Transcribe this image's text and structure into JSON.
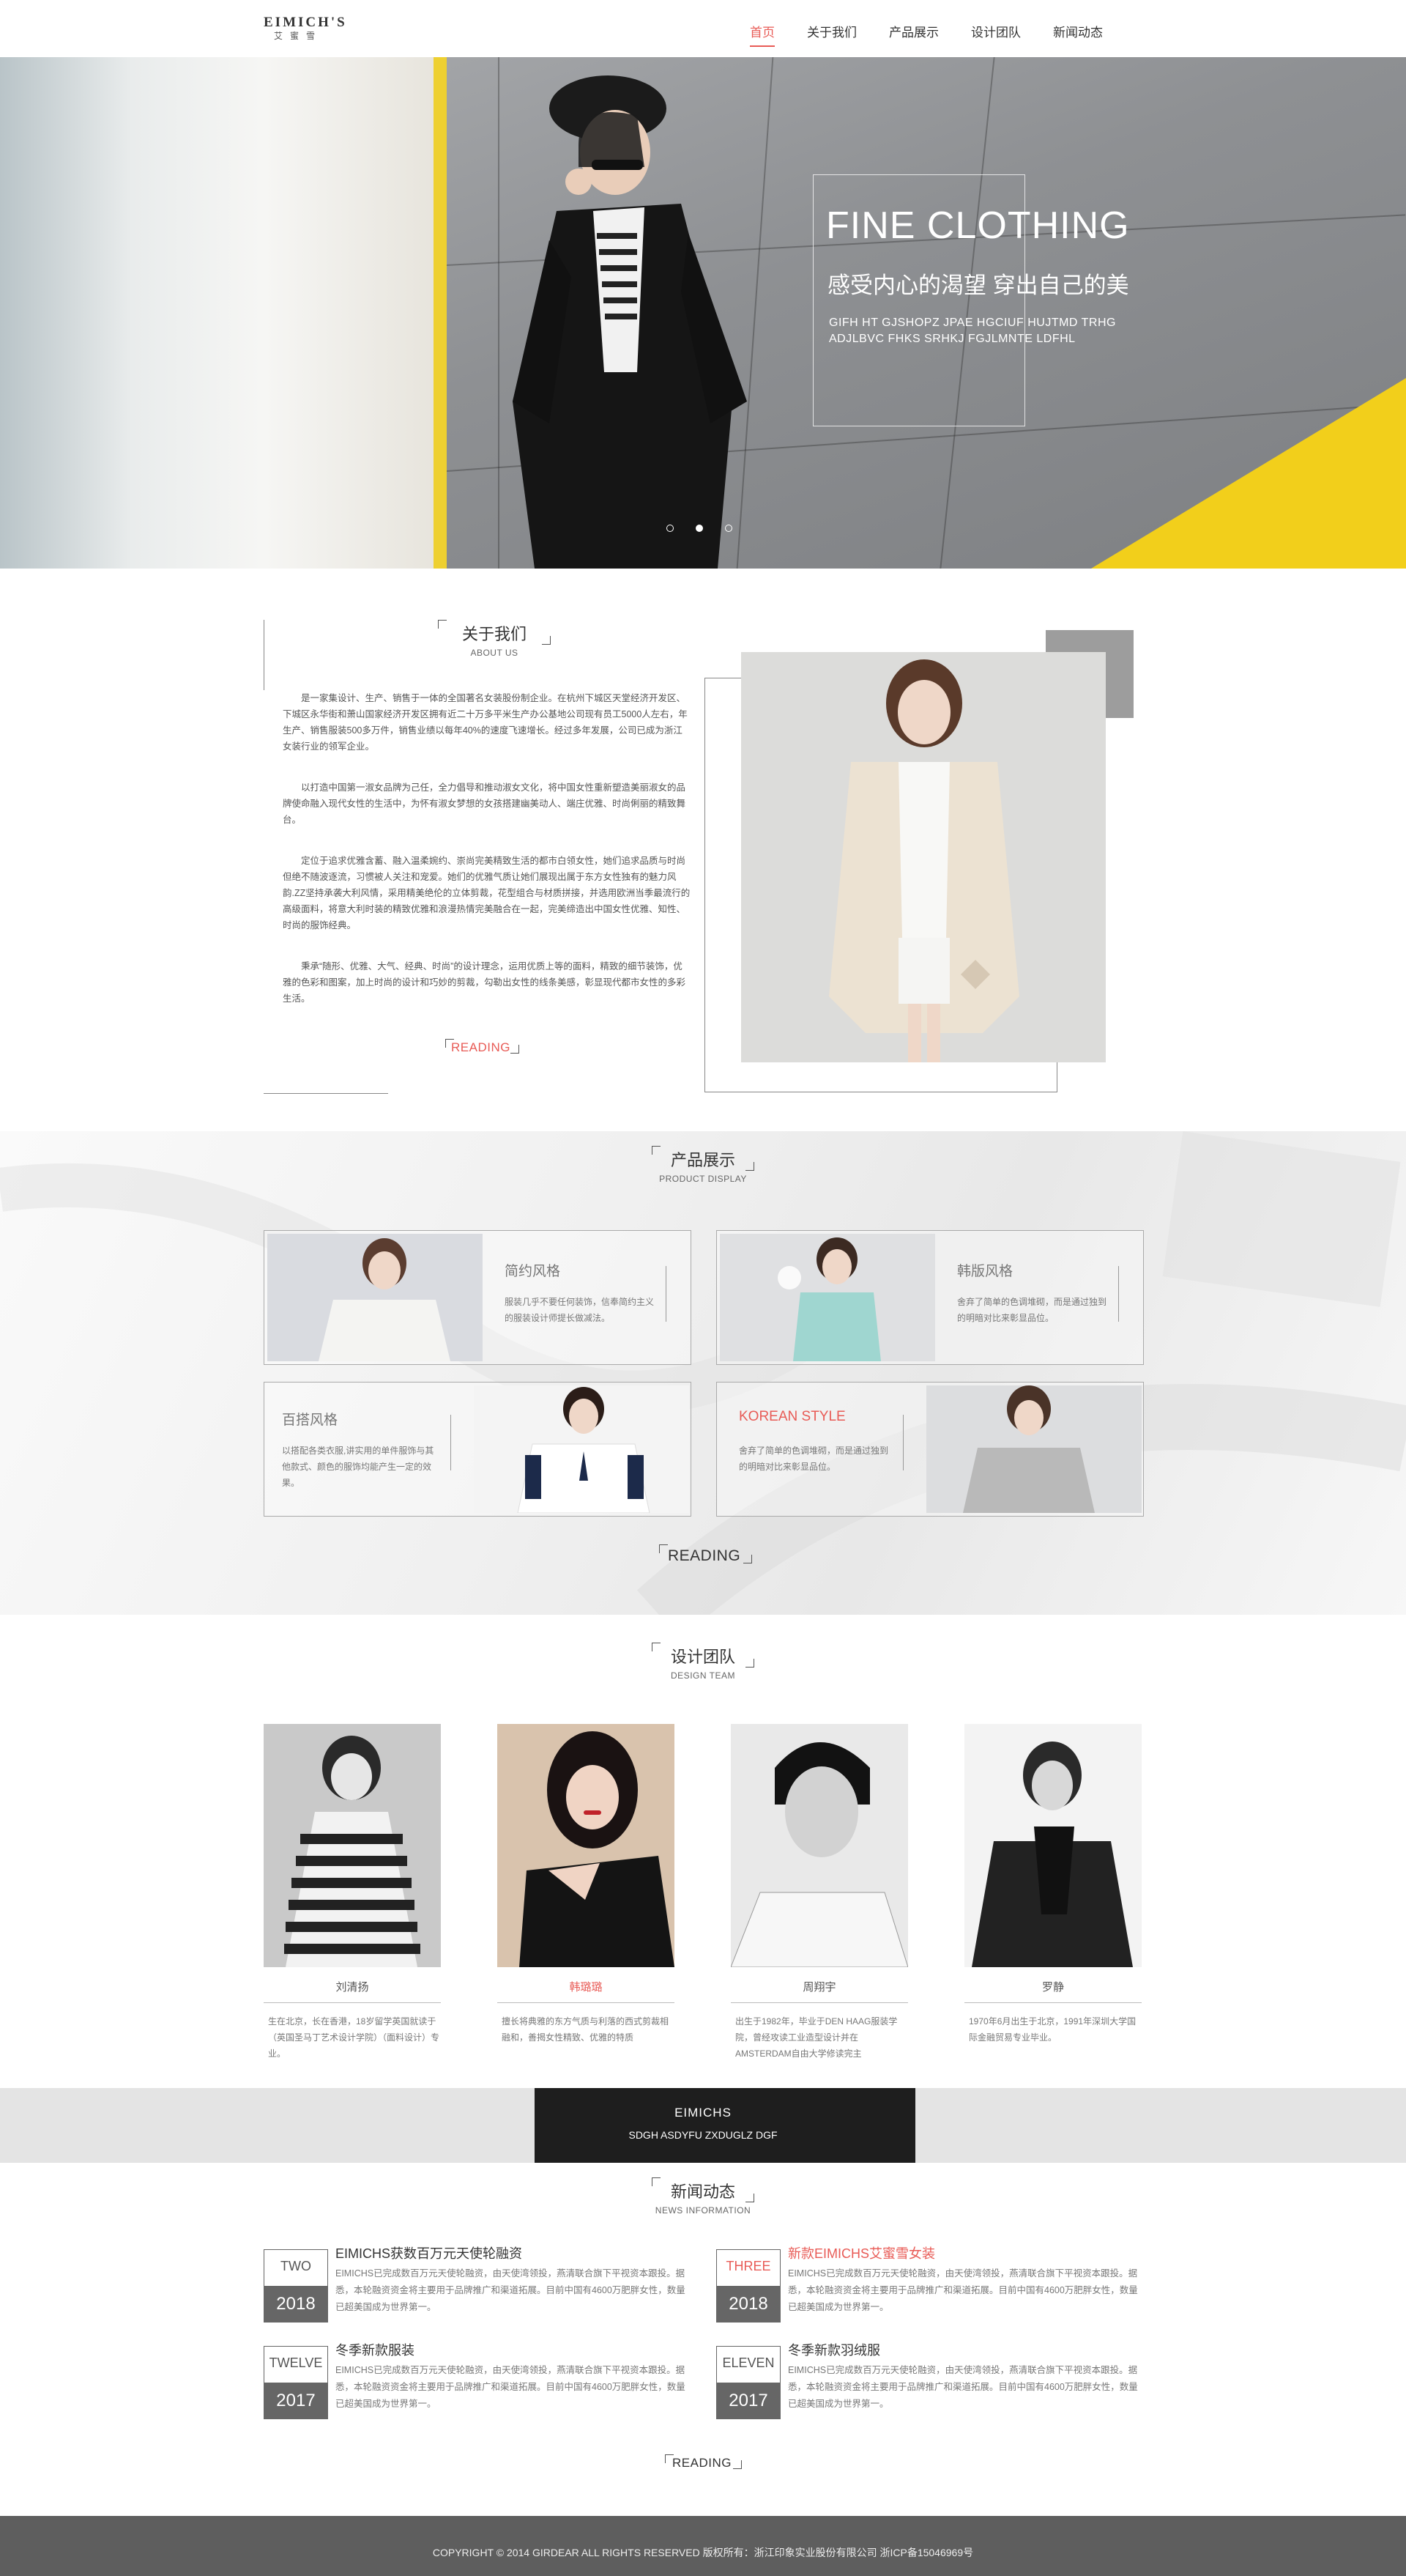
{
  "header": {
    "logo_en": "EIMICH'S",
    "logo_cn": "艾蜜雪",
    "nav": [
      "首页",
      "关于我们",
      "产品展示",
      "设计团队",
      "新闻动态"
    ]
  },
  "hero": {
    "title": "FINE CLOTHING",
    "subtitle": "感受内心的渴望 穿出自己的美",
    "desc": "GIFH HT GJSHOPZ JPAE HGCIUF HUJTMD TRHG ADJLBVC FHKS SRHKJ FGJLMNTE LDFHL",
    "slides": 3,
    "active_slide": 2
  },
  "about": {
    "title": "关于我们",
    "subtitle": "ABOUT US",
    "paragraphs": [
      "是一家集设计、生产、销售于一体的全国著名女装股份制企业。在杭州下城区天堂经济开发区、下城区永华街和萧山国家经济开发区拥有近二十万多平米生产办公基地公司现有员工5000人左右，年生产、销售服装500多万件，销售业绩以每年40%的速度飞速增长。经过多年发展，公司已成为浙江女装行业的领军企业。",
      "以打造中国第一淑女品牌为己任，全力倡导和推动淑女文化，将中国女性重新塑造美丽淑女的品牌使命融入现代女性的生活中，为怀有淑女梦想的女孩搭建幽美动人、端庄优雅、时尚俐丽的精致舞台。",
      "定位于追求优雅含蓄、融入温柔婉约、崇尚完美精致生活的都市白领女性，她们追求品质与时尚但绝不随波逐流，习惯被人关注和宠爱。她们的优雅气质让她们展现出属于东方女性独有的魅力风韵.ZZ坚持承袭大利风情，采用精美绝伦的立体剪裁，花型组合与材质拼接，并选用欧洲当季最流行的高级面料，将意大利时装的精致优雅和浪漫热情完美融合在一起，完美缔造出中国女性优雅、知性、时尚的服饰经典。",
      "秉承“随形、优雅、大气、经典、时尚”的设计理念，运用优质上等的面料，精致的细节装饰，优雅的色彩和图案，加上时尚的设计和巧妙的剪裁，勾勒出女性的线条美感，彰显现代都市女性的多彩生活。"
    ],
    "reading": "READING"
  },
  "products": {
    "title": "产品展示",
    "subtitle": "PRODUCT DISPLAY",
    "items": [
      {
        "name": "简约风格",
        "desc": "服装几乎不要任何装饰，信奉简约主义的服装设计师提长做减法。"
      },
      {
        "name": "韩版风格",
        "desc": "舍弃了简单的色调堆砌，而是通过独到的明暗对比来彰显品位。"
      },
      {
        "name": "百搭风格",
        "desc": "以搭配各类衣服,讲实用的单件服饰与其他款式、颜色的服饰均能产生一定的效果。"
      },
      {
        "name": "KOREAN STYLE",
        "desc": "舍弃了简单的色调堆砌，而是通过独到的明暗对比来彰显品位。"
      }
    ],
    "reading": "READING"
  },
  "team": {
    "title": "设计团队",
    "subtitle": "DESIGN TEAM",
    "members": [
      {
        "name": "刘清扬",
        "desc": "生在北京，长在香港，18岁留学英国就读于（英国圣马丁艺术设计学院）（面料设计）专业。"
      },
      {
        "name": "韩璐璐",
        "desc": "擅长将典雅的东方气质与利落的西式剪裁相融和，善揭女性精致、优雅的特质"
      },
      {
        "name": "周翔宇",
        "desc": "出生于1982年，毕业于DEN HAAG服装学院，曾经攻读工业造型设计并在AMSTERDAM自由大学修读完主"
      },
      {
        "name": "罗静",
        "desc": "1970年6月出生于北京，1991年深圳大学国际金融贸易专业毕业。"
      }
    ]
  },
  "banner": {
    "title": "EIMICHS",
    "sub": "SDGH ASDYFU ZXDUGLZ DGF"
  },
  "news": {
    "title": "新闻动态",
    "subtitle": "NEWS INFORMATION",
    "items": [
      {
        "word": "TWO",
        "year": "2018",
        "title": "EIMICHS获数百万元天使轮融资",
        "desc": "EIMICHS已完成数百万元天使轮融资，由天使湾领投，燕清联合旗下平视资本跟投。据悉，本轮融资资金将主要用于品牌推广和渠道拓展。目前中国有4600万肥胖女性，数量已超美国成为世界第一。"
      },
      {
        "word": "THREE",
        "year": "2018",
        "title": "新款EIMICHS艾蜜雪女装",
        "desc": "EIMICHS已完成数百万元天使轮融资，由天使湾领投，燕清联合旗下平视资本跟投。据悉，本轮融资资金将主要用于品牌推广和渠道拓展。目前中国有4600万肥胖女性，数量已超美国成为世界第一。"
      },
      {
        "word": "TWELVE",
        "year": "2017",
        "title": "冬季新款服装",
        "desc": "EIMICHS已完成数百万元天使轮融资，由天使湾领投，燕清联合旗下平视资本跟投。据悉，本轮融资资金将主要用于品牌推广和渠道拓展。目前中国有4600万肥胖女性，数量已超美国成为世界第一。"
      },
      {
        "word": "ELEVEN",
        "year": "2017",
        "title": "冬季新款羽绒服",
        "desc": "EIMICHS已完成数百万元天使轮融资，由天使湾领投，燕清联合旗下平视资本跟投。据悉，本轮融资资金将主要用于品牌推广和渠道拓展。目前中国有4600万肥胖女性，数量已超美国成为世界第一。"
      }
    ],
    "reading": "READING"
  },
  "footer": {
    "text": "COPYRIGHT © 2014 GIRDEAR ALL RIGHTS RESERVED 版权所有：浙江印象实业股份有限公司 浙ICP备15046969号"
  },
  "colors": {
    "accent": "#e85b56",
    "dark": "#666666",
    "footer": "#5e5e5e",
    "hero_yellow": "#f2cf1b"
  }
}
